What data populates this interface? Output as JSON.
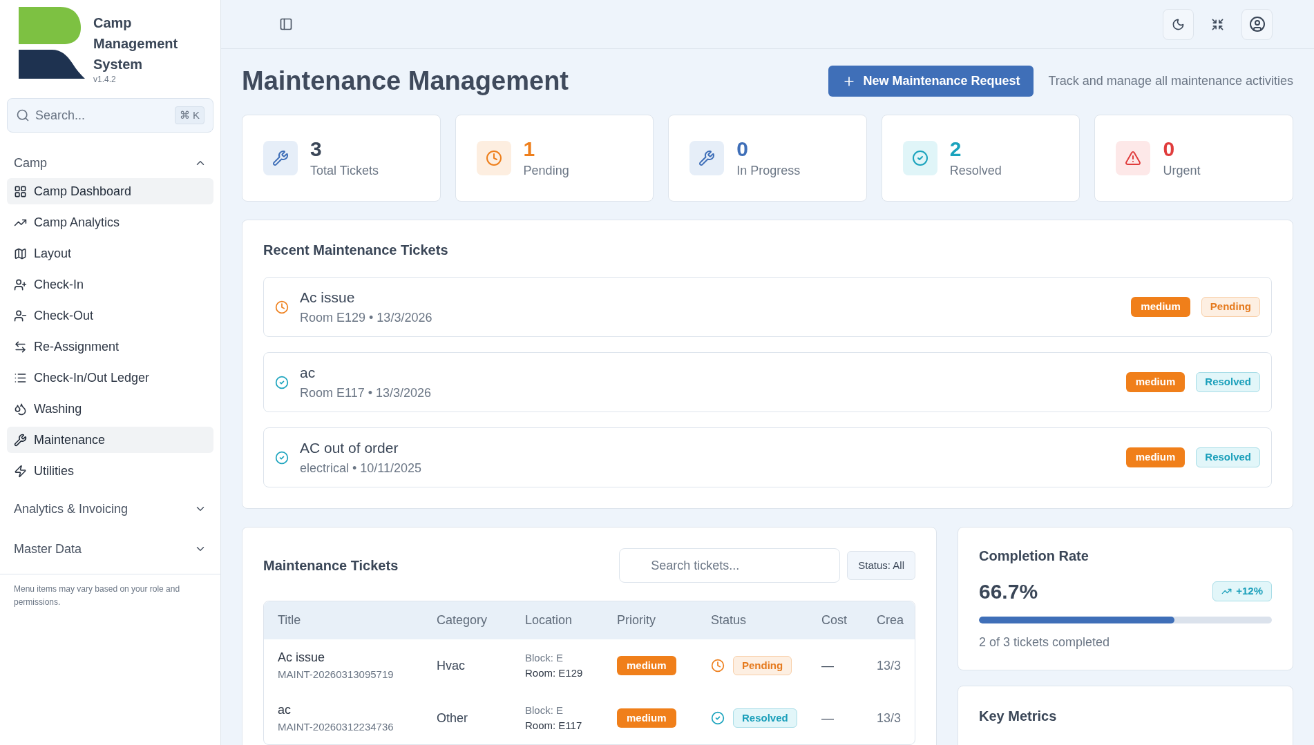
{
  "brand": {
    "title": "Camp Management System",
    "version": "v1.4.2"
  },
  "sidebar": {
    "search": {
      "placeholder": "Search...",
      "shortcut": "⌘ K"
    },
    "groups": [
      {
        "label": "Camp",
        "expanded": true,
        "items": [
          {
            "label": "Camp Dashboard",
            "kind": "dashboard",
            "selected": true
          },
          {
            "label": "Camp Analytics",
            "kind": "analytics",
            "selected": false
          },
          {
            "label": "Layout",
            "kind": "layout",
            "selected": false
          },
          {
            "label": "Check-In",
            "kind": "checkin",
            "selected": false
          },
          {
            "label": "Check-Out",
            "kind": "checkout",
            "selected": false
          },
          {
            "label": "Re-Assignment",
            "kind": "reassign",
            "selected": false
          },
          {
            "label": "Check-In/Out Ledger",
            "kind": "ledger",
            "selected": false
          },
          {
            "label": "Washing",
            "kind": "washing",
            "selected": false
          },
          {
            "label": "Maintenance",
            "kind": "maintenance",
            "selected": true
          },
          {
            "label": "Utilities",
            "kind": "utilities",
            "selected": false
          }
        ]
      },
      {
        "label": "Analytics & Invoicing",
        "expanded": false
      },
      {
        "label": "Master Data",
        "expanded": false
      }
    ],
    "footer_note": "Menu items may vary based on your role and permissions."
  },
  "page": {
    "title": "Maintenance Management",
    "new_button": "New Maintenance Request",
    "subtitle": "Track and manage all maintenance activities"
  },
  "stats": [
    {
      "kind": "total",
      "value": "3",
      "label": "Total Tickets"
    },
    {
      "kind": "pending",
      "value": "1",
      "label": "Pending"
    },
    {
      "kind": "progress",
      "value": "0",
      "label": "In Progress"
    },
    {
      "kind": "resolved",
      "value": "2",
      "label": "Resolved"
    },
    {
      "kind": "urgent",
      "value": "0",
      "label": "Urgent"
    }
  ],
  "recent": {
    "title": "Recent Maintenance Tickets",
    "tickets": [
      {
        "title": "Ac issue",
        "meta": "Room E129 • 13/3/2026",
        "priority": "medium",
        "status": "Pending",
        "kind": "pending"
      },
      {
        "title": "ac",
        "meta": "Room E117 • 13/3/2026",
        "priority": "medium",
        "status": "Resolved",
        "kind": "resolved"
      },
      {
        "title": "AC out of order",
        "meta": "electrical • 10/11/2025",
        "priority": "medium",
        "status": "Resolved",
        "kind": "resolved"
      }
    ]
  },
  "tickets_table": {
    "title": "Maintenance Tickets",
    "search_placeholder": "Search tickets...",
    "status_filter": "Status: All",
    "columns": [
      "Title",
      "Category",
      "Location",
      "Priority",
      "Status",
      "Cost",
      "Crea"
    ],
    "rows": [
      {
        "title": "Ac issue",
        "id": "MAINT-20260313095719",
        "category": "Hvac",
        "block": "Block: E",
        "room": "Room: E129",
        "priority": "medium",
        "status": "Pending",
        "kind": "pending",
        "cost": "—",
        "created": "13/3"
      },
      {
        "title": "ac",
        "id": "MAINT-20260312234736",
        "category": "Other",
        "block": "Block: E",
        "room": "Room: E117",
        "priority": "medium",
        "status": "Resolved",
        "kind": "resolved",
        "cost": "—",
        "created": "13/3"
      }
    ]
  },
  "completion": {
    "title": "Completion Rate",
    "value": "66.7%",
    "trend": "+12%",
    "level": 0.667,
    "note": "2 of 3 tickets completed"
  },
  "key_metrics": {
    "title": "Key Metrics"
  }
}
